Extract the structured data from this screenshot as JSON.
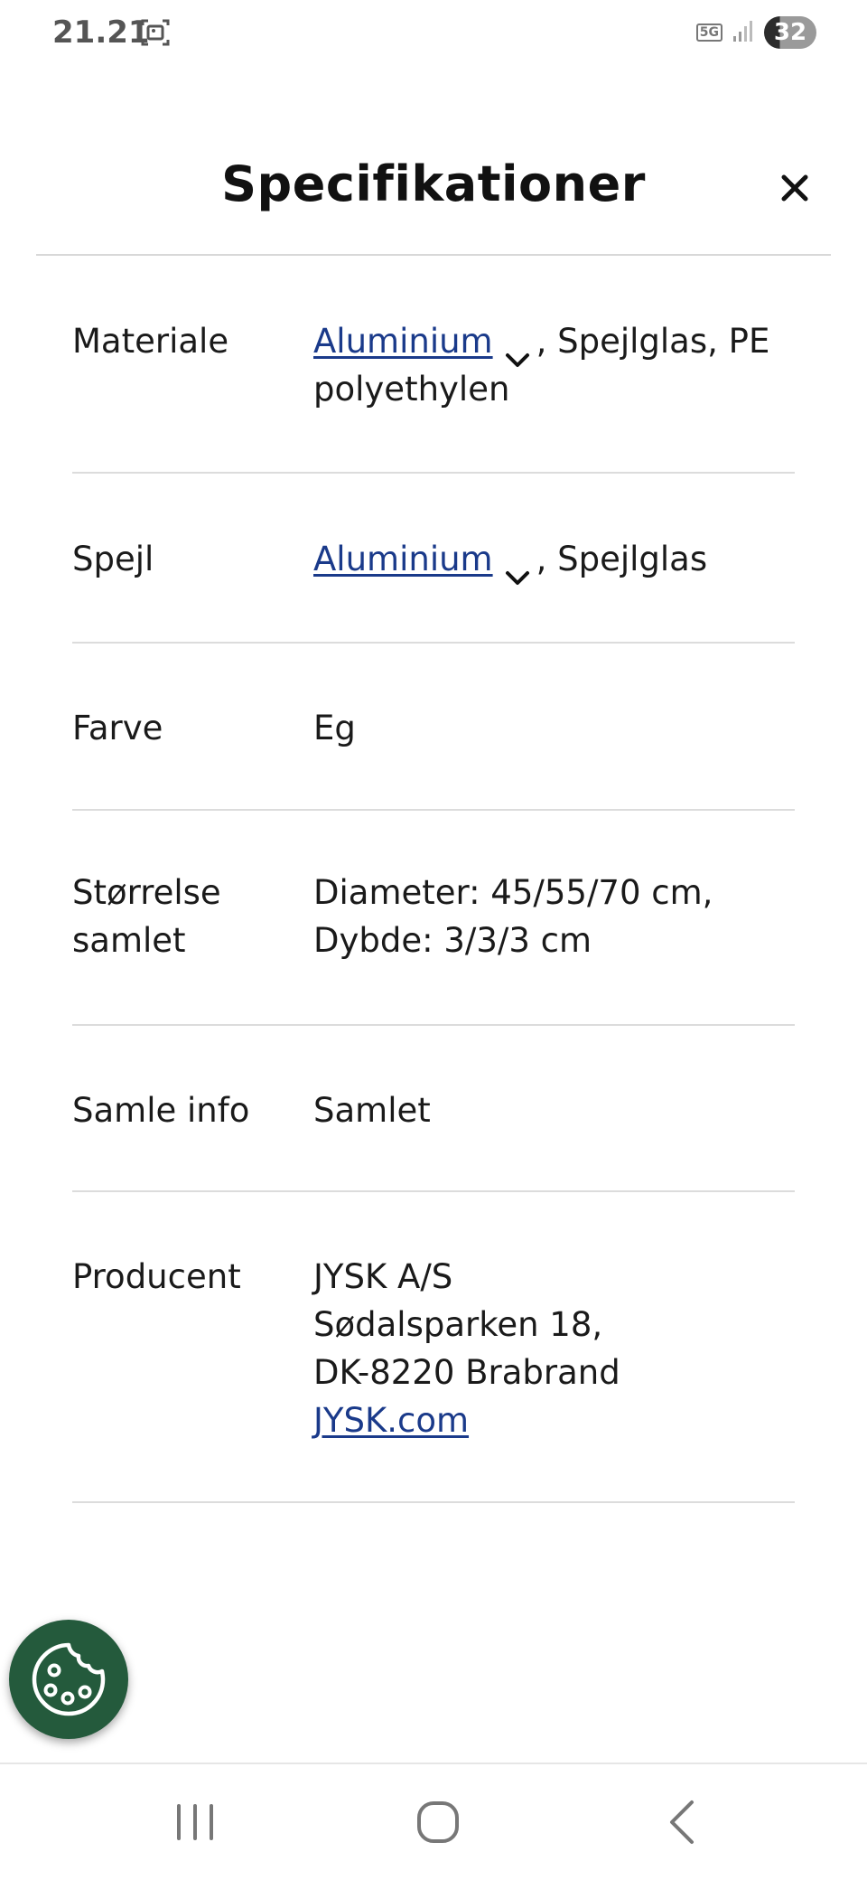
{
  "status_bar": {
    "time": "21.21",
    "network": "5G",
    "battery": "32"
  },
  "header": {
    "title": "Specifikationer"
  },
  "specs": {
    "materiale": {
      "label": "Materiale",
      "link": "Aluminium",
      "rest_line1": ", Spejlglas, PE",
      "rest_line2": "polyethylen"
    },
    "spejl": {
      "label": "Spejl",
      "link": "Aluminium",
      "rest_line1": ", Spejlglas"
    },
    "farve": {
      "label": "Farve",
      "value": "Eg"
    },
    "stoerrelse": {
      "label_line1": "Størrelse",
      "label_line2": "samlet",
      "value_line1": "Diameter: 45/55/70 cm,",
      "value_line2": "Dybde: 3/3/3 cm"
    },
    "samle_info": {
      "label": "Samle info",
      "value": "Samlet"
    },
    "producent": {
      "label": "Producent",
      "line1": "JYSK A/S",
      "line2": "Sødalsparken 18,",
      "line3": "DK-8220 Brabrand",
      "link": "JYSK.com"
    }
  },
  "icons": {
    "close": "close-icon",
    "chevron": "chevron-down-icon",
    "cookie": "cookie-icon",
    "nav_recents": "recent-apps-icon",
    "nav_home": "home-icon",
    "nav_back": "back-icon"
  },
  "colors": {
    "link": "#1a3a8a",
    "cookie_button": "#245a3c",
    "divider": "#dcdcdc"
  }
}
